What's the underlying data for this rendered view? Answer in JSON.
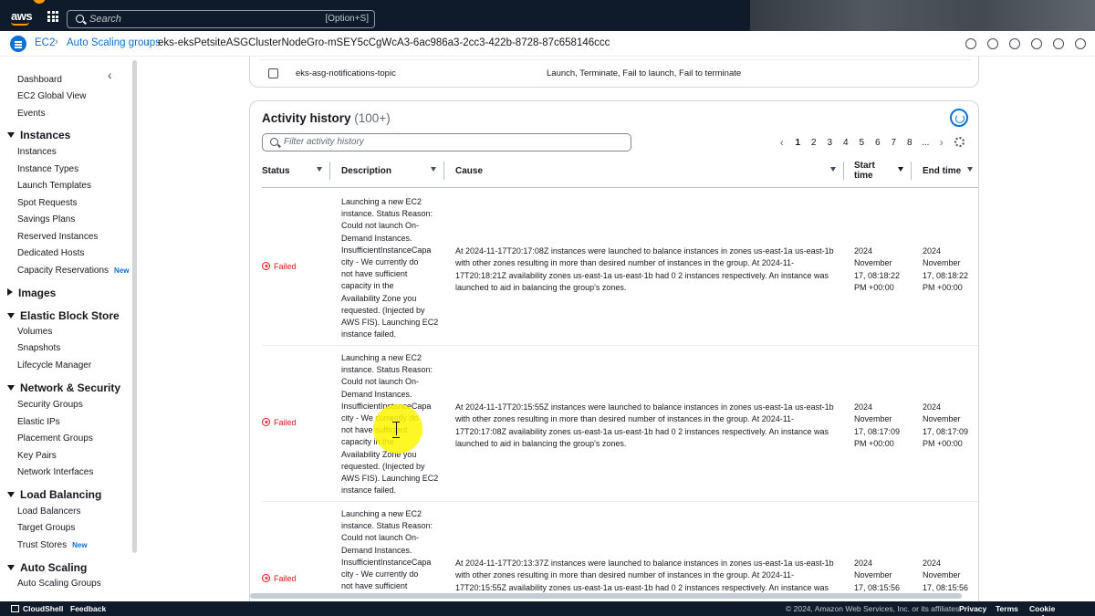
{
  "topbar": {
    "logo": "aws",
    "search_placeholder": "Search",
    "search_shortcut": "[Option+S]"
  },
  "breadcrumb": {
    "items": [
      "EC2",
      "Auto Scaling groups"
    ],
    "current": "eks-eksPetsiteASGClusterNodeGro-mSEY5cCgWcA3-6ac986a3-2cc3-422b-8728-87c658146ccc"
  },
  "sidebar": {
    "items": [
      {
        "label": "Dashboard",
        "type": "item"
      },
      {
        "label": "EC2 Global View",
        "type": "item"
      },
      {
        "label": "Events",
        "type": "item"
      },
      {
        "label": "Instances",
        "type": "section",
        "expanded": true
      },
      {
        "label": "Instances",
        "type": "item"
      },
      {
        "label": "Instance Types",
        "type": "item"
      },
      {
        "label": "Launch Templates",
        "type": "item"
      },
      {
        "label": "Spot Requests",
        "type": "item"
      },
      {
        "label": "Savings Plans",
        "type": "item"
      },
      {
        "label": "Reserved Instances",
        "type": "item"
      },
      {
        "label": "Dedicated Hosts",
        "type": "item"
      },
      {
        "label": "Capacity Reservations",
        "type": "item",
        "badge": "New"
      },
      {
        "label": "Images",
        "type": "section",
        "expanded": false
      },
      {
        "label": "Elastic Block Store",
        "type": "section",
        "expanded": true
      },
      {
        "label": "Volumes",
        "type": "item"
      },
      {
        "label": "Snapshots",
        "type": "item"
      },
      {
        "label": "Lifecycle Manager",
        "type": "item"
      },
      {
        "label": "Network & Security",
        "type": "section",
        "expanded": true
      },
      {
        "label": "Security Groups",
        "type": "item"
      },
      {
        "label": "Elastic IPs",
        "type": "item"
      },
      {
        "label": "Placement Groups",
        "type": "item"
      },
      {
        "label": "Key Pairs",
        "type": "item"
      },
      {
        "label": "Network Interfaces",
        "type": "item"
      },
      {
        "label": "Load Balancing",
        "type": "section",
        "expanded": true
      },
      {
        "label": "Load Balancers",
        "type": "item"
      },
      {
        "label": "Target Groups",
        "type": "item"
      },
      {
        "label": "Trust Stores",
        "type": "item",
        "badge": "New"
      },
      {
        "label": "Auto Scaling",
        "type": "section",
        "expanded": true
      },
      {
        "label": "Auto Scaling Groups",
        "type": "item"
      }
    ]
  },
  "notifications": {
    "topic": "eks-asg-notifications-topic",
    "events": "Launch, Terminate, Fail to launch, Fail to terminate"
  },
  "activity": {
    "title": "Activity history",
    "count": "(100+)",
    "filter_placeholder": "Filter activity history",
    "pages": [
      "1",
      "2",
      "3",
      "4",
      "5",
      "6",
      "7",
      "8",
      "..."
    ],
    "current_page": "1",
    "columns": {
      "status": "Status",
      "description": "Description",
      "cause": "Cause",
      "start_time": "Start time",
      "end_time": "End time"
    },
    "rows": [
      {
        "status": "Failed",
        "description": [
          "Launching a new EC2",
          "instance. Status Reason:",
          "Could not launch On-",
          "Demand Instances.",
          "InsufficientInstanceCapa",
          "city - We currently do",
          "not have sufficient",
          "capacity in the",
          "Availability Zone you",
          "requested. (Injected by",
          "AWS FIS). Launching EC2",
          "instance failed."
        ],
        "cause": [
          "At 2024-11-17T20:17:08Z instances were launched to balance instances in zones us-east-1a us-east-1b",
          "with other zones resulting in more than desired number of instances in the group. At 2024-11-",
          "17T20:18:21Z availability zones us-east-1a us-east-1b had 0 2 instances respectively. An instance was",
          "launched to aid in balancing the group's zones."
        ],
        "start": [
          "2024",
          "November",
          "17, 08:18:22",
          "PM +00:00"
        ],
        "end": [
          "2024",
          "November",
          "17, 08:18:22",
          "PM +00:00"
        ]
      },
      {
        "status": "Failed",
        "description": [
          "Launching a new EC2",
          "instance. Status Reason:",
          "Could not launch On-",
          "Demand Instances.",
          "InsufficientInstanceCapa",
          "city - We currently do",
          "not have sufficient",
          "capacity in the",
          "Availability Zone you",
          "requested. (Injected by",
          "AWS FIS). Launching EC2",
          "instance failed."
        ],
        "cause": [
          "At 2024-11-17T20:15:55Z instances were launched to balance instances in zones us-east-1a us-east-1b",
          "with other zones resulting in more than desired number of instances in the group. At 2024-11-",
          "17T20:17:08Z availability zones us-east-1a us-east-1b had 0 2 instances respectively. An instance was",
          "launched to aid in balancing the group's zones."
        ],
        "start": [
          "2024",
          "November",
          "17, 08:17:09",
          "PM +00:00"
        ],
        "end": [
          "2024",
          "November",
          "17, 08:17:09",
          "PM +00:00"
        ]
      },
      {
        "status": "Failed",
        "description": [
          "Launching a new EC2",
          "instance. Status Reason:",
          "Could not launch On-",
          "Demand Instances.",
          "InsufficientInstanceCapa",
          "city - We currently do",
          "not have sufficient"
        ],
        "cause": [
          "At 2024-11-17T20:13:37Z instances were launched to balance instances in zones us-east-1a us-east-1b",
          "with other zones resulting in more than desired number of instances in the group. At 2024-11-",
          "17T20:15:55Z availability zones us-east-1a us-east-1b had 0 2 instances respectively. An instance was"
        ],
        "start": [
          "2024",
          "November",
          "17, 08:15:56"
        ],
        "end": [
          "2024",
          "November",
          "17, 08:15:56"
        ]
      }
    ]
  },
  "footer": {
    "cloudshell": "CloudShell",
    "feedback": "Feedback",
    "copyright": "© 2024, Amazon Web Services, Inc. or its affiliates.",
    "privacy": "Privacy",
    "terms": "Terms",
    "cookies": "Cookie preferences"
  },
  "colors": {
    "nav_bg": "#0f1b2a",
    "link": "#0972d3",
    "error": "#d91515",
    "brand_orange": "#ff9900"
  }
}
